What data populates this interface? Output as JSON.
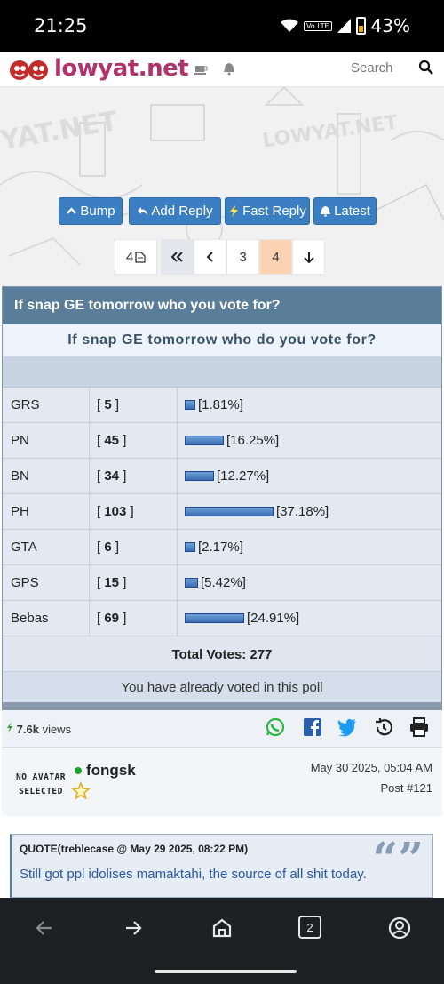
{
  "status_bar": {
    "time": "21:25",
    "network": "Vo LTE",
    "battery": "43%"
  },
  "header": {
    "brand": "lowyat.net",
    "search_placeholder": "Search"
  },
  "actions": {
    "bump": "Bump",
    "add_reply": "Add Reply",
    "fast_reply": "Fast Reply",
    "latest": "Latest"
  },
  "pager": {
    "total_pages": "4",
    "pages": [
      "3",
      "4"
    ],
    "current": "4"
  },
  "poll": {
    "title": "If snap GE tomorrow who you vote for?",
    "question": "If snap GE tomorrow who do you vote for?",
    "rows": [
      {
        "option": "GRS",
        "votes": "5",
        "percent": "[1.81%]",
        "pct": 1.81
      },
      {
        "option": "PN",
        "votes": "45",
        "percent": "[16.25%]",
        "pct": 16.25
      },
      {
        "option": "BN",
        "votes": "34",
        "percent": "[12.27%]",
        "pct": 12.27
      },
      {
        "option": "PH",
        "votes": "103",
        "percent": "[37.18%]",
        "pct": 37.18
      },
      {
        "option": "GTA",
        "votes": "6",
        "percent": "[2.17%]",
        "pct": 2.17
      },
      {
        "option": "GPS",
        "votes": "15",
        "percent": "[5.42%]",
        "pct": 5.42
      },
      {
        "option": "Bebas",
        "votes": "69",
        "percent": "[24.91%]",
        "pct": 24.91
      }
    ],
    "total": "Total Votes: 277",
    "voted_msg": "You have already voted in this poll"
  },
  "views": {
    "count": "7.6k",
    "label": "views"
  },
  "post": {
    "avatar_text_1": "NO AVATAR",
    "avatar_text_2": "SELECTED",
    "username": "fongsk",
    "date": "May 30 2025, 05:04 AM",
    "number": "Post #121",
    "quote_header": "QUOTE(treblecase @ May 29 2025, 08:22 PM)",
    "quote_text": "Still got ppl idolises mamaktahi, the source of all shit today."
  },
  "nav": {
    "tabs_count": "2"
  },
  "colors": {
    "brand": "#b0336b",
    "button": "#3b7fc2",
    "poll_header": "#5a7d9a",
    "active_page": "#fbd3b3"
  }
}
